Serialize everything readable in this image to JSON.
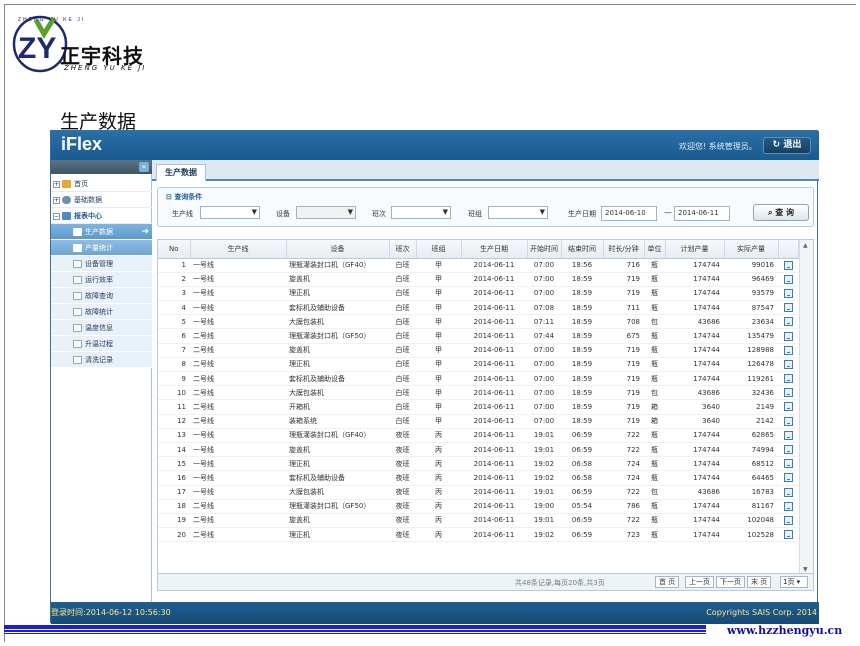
{
  "slide": {
    "logo_mark": "ZY",
    "logo_arc_text": "ZHENG YU KE JI",
    "logo_cn": "正宇科技",
    "logo_en": "ZHENG YU KE JI",
    "title": "生产数据",
    "website": "www.hzzhengyu.cn"
  },
  "app": {
    "name": "iFlex",
    "user_greeting": "欢迎您! 系统管理员。",
    "exit_label": "退出",
    "login_time": "登录时间:2014-06-12 10:56:30",
    "copyright": "Copyrights SAIS Corp. 2014"
  },
  "sidebar": {
    "collapse_glyph": "«",
    "items": [
      {
        "label": "首页",
        "level": 0
      },
      {
        "label": "基础数据",
        "level": 0
      },
      {
        "label": "报表中心",
        "level": 0
      },
      {
        "label": "生产数据",
        "level": 1,
        "active": true
      },
      {
        "label": "产量统计",
        "level": 1
      },
      {
        "label": "设备管理",
        "level": 1
      },
      {
        "label": "运行效率",
        "level": 1
      },
      {
        "label": "故障查询",
        "level": 1
      },
      {
        "label": "故障统计",
        "level": 1
      },
      {
        "label": "温度信息",
        "level": 1
      },
      {
        "label": "升温过程",
        "level": 1
      },
      {
        "label": "清洗记录",
        "level": 1
      }
    ]
  },
  "tabs": [
    {
      "label": "生产数据"
    }
  ],
  "query": {
    "title": "查询条件",
    "line_label": "生产线",
    "device_label": "设备",
    "shift_label": "班次",
    "team_label": "班组",
    "date_label": "生产日期",
    "date_from": "2014-06-10",
    "date_to": "2014-06-11",
    "date_sep": "—",
    "search_label": "查 询"
  },
  "table": {
    "columns": [
      "No",
      "生产线",
      "设备",
      "班次",
      "班组",
      "生产日期",
      "开始时间",
      "结束时间",
      "时长/分钟",
      "单位",
      "计划产量",
      "实际产量",
      ""
    ],
    "rows": [
      [
        "1",
        "一号线",
        "理瓶灌装封口机（GF40）",
        "白班",
        "甲",
        "2014-06-11",
        "07:00",
        "18:56",
        "716",
        "瓶",
        "174744",
        "99016"
      ],
      [
        "2",
        "一号线",
        "旋盖机",
        "白班",
        "甲",
        "2014-06-11",
        "07:00",
        "18:59",
        "719",
        "瓶",
        "174744",
        "96469"
      ],
      [
        "3",
        "一号线",
        "理正机",
        "白班",
        "甲",
        "2014-06-11",
        "07:00",
        "18:59",
        "719",
        "瓶",
        "174744",
        "93579"
      ],
      [
        "4",
        "一号线",
        "套标机及辅助设备",
        "白班",
        "甲",
        "2014-06-11",
        "07:08",
        "18:59",
        "711",
        "瓶",
        "174744",
        "87547"
      ],
      [
        "5",
        "一号线",
        "大膜包装机",
        "白班",
        "甲",
        "2014-06-11",
        "07:11",
        "18:59",
        "708",
        "包",
        "43686",
        "23634"
      ],
      [
        "6",
        "二号线",
        "理瓶灌装封口机（GF50）",
        "白班",
        "甲",
        "2014-06-11",
        "07:44",
        "18:59",
        "675",
        "瓶",
        "174744",
        "135479"
      ],
      [
        "7",
        "二号线",
        "旋盖机",
        "白班",
        "甲",
        "2014-06-11",
        "07:00",
        "18:59",
        "719",
        "瓶",
        "174744",
        "128988"
      ],
      [
        "8",
        "二号线",
        "理正机",
        "白班",
        "甲",
        "2014-06-11",
        "07:00",
        "18:59",
        "719",
        "瓶",
        "174744",
        "126478"
      ],
      [
        "9",
        "二号线",
        "套标机及辅助设备",
        "白班",
        "甲",
        "2014-06-11",
        "07:00",
        "18:59",
        "719",
        "瓶",
        "174744",
        "119261"
      ],
      [
        "10",
        "二号线",
        "大膜包装机",
        "白班",
        "甲",
        "2014-06-11",
        "07:00",
        "18:59",
        "719",
        "包",
        "43686",
        "32436"
      ],
      [
        "11",
        "二号线",
        "开箱机",
        "白班",
        "甲",
        "2014-06-11",
        "07:00",
        "18:59",
        "719",
        "箱",
        "3640",
        "2149"
      ],
      [
        "12",
        "二号线",
        "装箱系统",
        "白班",
        "甲",
        "2014-06-11",
        "07:00",
        "18:59",
        "719",
        "箱",
        "3640",
        "2142"
      ],
      [
        "13",
        "一号线",
        "理瓶灌装封口机（GF40）",
        "夜班",
        "丙",
        "2014-06-11",
        "19:01",
        "06:59",
        "722",
        "瓶",
        "174744",
        "62865"
      ],
      [
        "14",
        "一号线",
        "旋盖机",
        "夜班",
        "丙",
        "2014-06-11",
        "19:01",
        "06:59",
        "722",
        "瓶",
        "174744",
        "74994"
      ],
      [
        "15",
        "一号线",
        "理正机",
        "夜班",
        "丙",
        "2014-06-11",
        "19:02",
        "06:58",
        "724",
        "瓶",
        "174744",
        "68512"
      ],
      [
        "16",
        "一号线",
        "套标机及辅助设备",
        "夜班",
        "丙",
        "2014-06-11",
        "19:02",
        "06:58",
        "724",
        "瓶",
        "174744",
        "64465"
      ],
      [
        "17",
        "一号线",
        "大膜包装机",
        "夜班",
        "丙",
        "2014-06-11",
        "19:01",
        "06:59",
        "722",
        "包",
        "43686",
        "16783"
      ],
      [
        "18",
        "二号线",
        "理瓶灌装封口机（GF50）",
        "夜班",
        "丙",
        "2014-06-11",
        "19:00",
        "05:54",
        "786",
        "瓶",
        "174744",
        "81167"
      ],
      [
        "19",
        "二号线",
        "旋盖机",
        "夜班",
        "丙",
        "2014-06-11",
        "19:01",
        "06:59",
        "722",
        "瓶",
        "174744",
        "102048"
      ],
      [
        "20",
        "二号线",
        "理正机",
        "夜班",
        "丙",
        "2014-06-11",
        "19:02",
        "06:59",
        "723",
        "瓶",
        "174744",
        "102528"
      ]
    ]
  },
  "pager": {
    "info": "共48条记录,每页20条,共3页",
    "first": "首 页",
    "prev": "上一页",
    "next": "下一页",
    "last": "末 页",
    "page_select": "1页 ▾"
  },
  "colors": {
    "header_blue": "#1a5b8f",
    "active_nav": "#5d98cc",
    "footer_text": "#ffe680",
    "slide_bar": "#1d1dd6"
  }
}
